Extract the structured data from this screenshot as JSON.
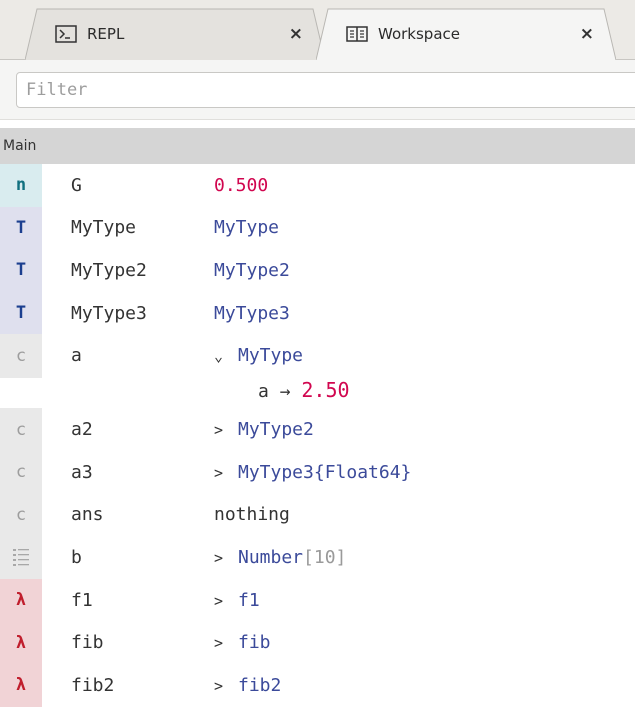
{
  "tabs": [
    {
      "label": "REPL",
      "icon": "terminal-icon",
      "close": "×"
    },
    {
      "label": "Workspace",
      "icon": "workspace-book-icon",
      "close": "×"
    }
  ],
  "filter": {
    "placeholder": "Filter",
    "value": ""
  },
  "section": {
    "title": "Main"
  },
  "rows": [
    {
      "badge": "n",
      "name": "G",
      "value": "0.500"
    },
    {
      "badge": "T",
      "name": "MyType",
      "value": "MyType"
    },
    {
      "badge": "T",
      "name": "MyType2",
      "value": "MyType2"
    },
    {
      "badge": "T",
      "name": "MyType3",
      "value": "MyType3"
    },
    {
      "badge": "c",
      "name": "a",
      "expander": "⌄",
      "value": "MyType",
      "field": {
        "name": "a",
        "arrow": "→",
        "value": "2.50"
      }
    },
    {
      "badge": "c",
      "name": "a2",
      "expander": ">",
      "value": "MyType2"
    },
    {
      "badge": "c",
      "name": "a3",
      "expander": ">",
      "value": "MyType3{Float64}"
    },
    {
      "badge": "c",
      "name": "ans",
      "value": "nothing"
    },
    {
      "badge": "list-icon",
      "name": "b",
      "expander": ">",
      "value": "Number",
      "suffix": "[10]"
    },
    {
      "badge": "λ",
      "name": "f1",
      "expander": ">",
      "value": "f1"
    },
    {
      "badge": "λ",
      "name": "fib",
      "expander": ">",
      "value": "fib"
    },
    {
      "badge": "λ",
      "name": "fib2",
      "expander": ">",
      "value": "fib2"
    }
  ],
  "colors": {
    "number": "#d1064f",
    "type": "#3b4a9a",
    "badge_number_bg": "#d9ecef",
    "badge_type_bg": "#dfe0ee",
    "badge_const_bg": "#e9e9e9",
    "badge_lambda_bg": "#f1d3d6"
  }
}
